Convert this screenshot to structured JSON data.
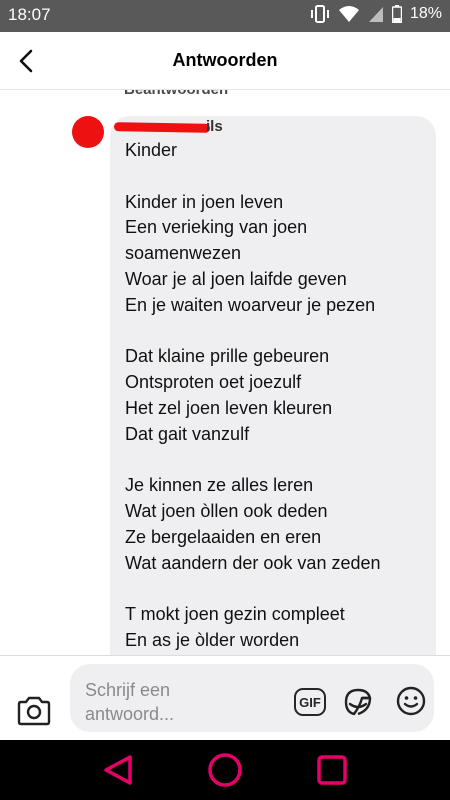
{
  "status_bar": {
    "time": "18:07",
    "battery": "18%",
    "icons": [
      "vibrate-icon",
      "wifi-icon",
      "signal-icon",
      "battery-icon"
    ]
  },
  "header": {
    "title": "Antwoorden",
    "back_icon": "back-arrow-icon"
  },
  "thread": {
    "cutoff_label": "Beantwoorden",
    "username_visible_fragment": "ils",
    "message": "Kinder\n\nKinder in joen leven\nEen verieking van joen\nsoamenwezen\nWoar je al joen laifde  geven\nEn je waiten woarveur je pezen\n\nDat klaine prille gebeuren\nOntsproten oet joezulf\nHet zel joen leven kleuren\nDat gait vanzulf\n\nJe kinnen ze alles leren\nWat joen òllen ook deden\nZe bergelaaiden en eren\nWat aandern der ook van zeden\n\nT mokt joen gezin compleet\nEn as je òlder worden"
  },
  "composer": {
    "placeholder": "Schrijf een antwoord...",
    "gif_label": "GIF",
    "icons": [
      "camera-icon",
      "gif-icon",
      "sticker-icon",
      "emoji-icon"
    ]
  },
  "nav": {
    "icons": [
      "nav-back-icon",
      "nav-home-icon",
      "nav-recents-icon"
    ]
  },
  "colors": {
    "status_bar": "#595959",
    "bubble": "#efeff2",
    "redaction": "#ee1111",
    "nav_accent": "#e8006a"
  }
}
